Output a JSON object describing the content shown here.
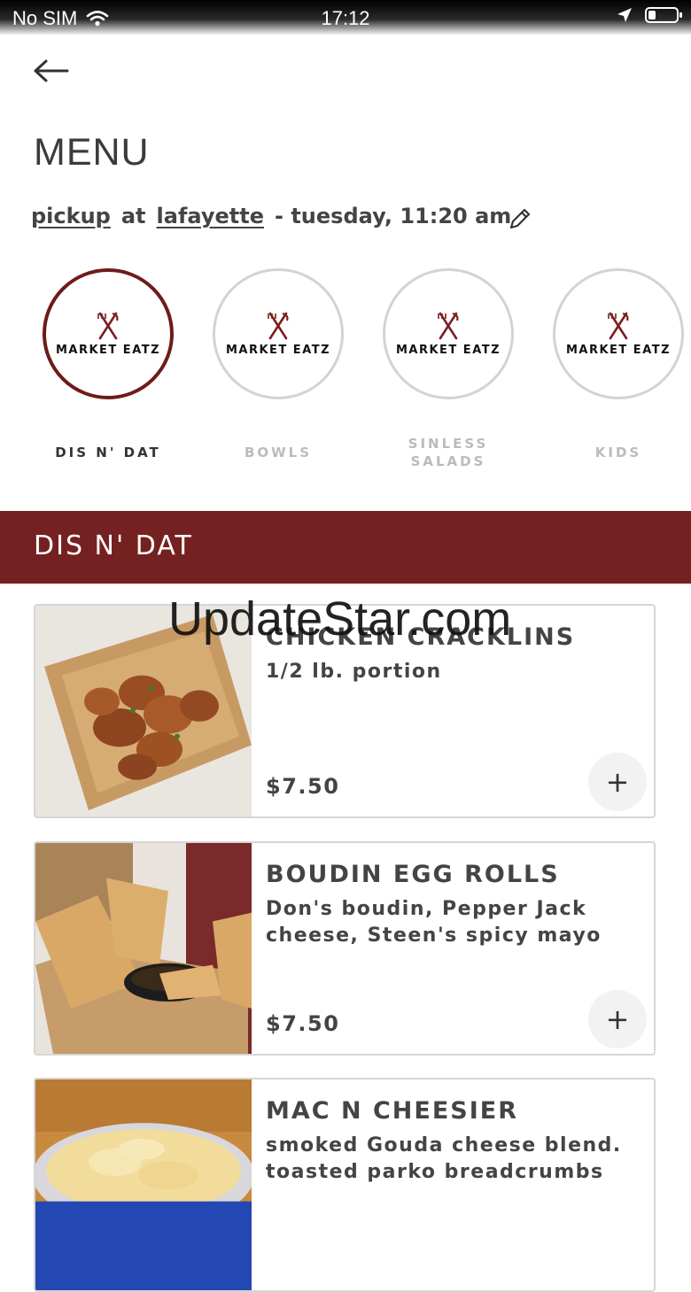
{
  "status_bar": {
    "carrier": "No SIM",
    "time": "17:12"
  },
  "header": {
    "title": "MENU"
  },
  "order_context": {
    "mode": "pickup",
    "connector": "at",
    "location": "lafayette",
    "when": "- tuesday, 11:20 am"
  },
  "categories": [
    {
      "brand": "MARKET EATZ",
      "label": "DIS N' DAT",
      "active": true
    },
    {
      "brand": "MARKET EATZ",
      "label": "BOWLS",
      "active": false
    },
    {
      "brand": "MARKET EATZ",
      "label": "SINLESS SALADS",
      "active": false
    },
    {
      "brand": "MARKET EATZ",
      "label": "KIDS",
      "active": false
    }
  ],
  "section": {
    "title": "DIS N' DAT"
  },
  "items": [
    {
      "name": "CHICKEN CRACKLINS",
      "description": "1/2 lb. portion",
      "price": "$7.50",
      "add_label": "+"
    },
    {
      "name": "BOUDIN EGG ROLLS",
      "description": "Don's boudin, Pepper Jack cheese, Steen's spicy mayo",
      "price": "$7.50",
      "add_label": "+"
    },
    {
      "name": "MAC N CHEESIER",
      "description": "smoked Gouda cheese blend. toasted parko breadcrumbs",
      "price": "",
      "add_label": "+"
    }
  ],
  "watermark": "UpdateStar.com",
  "colors": {
    "brand_maroon": "#762121",
    "active_ring": "#6e1b1b",
    "inactive_text": "#bbbbbb"
  }
}
